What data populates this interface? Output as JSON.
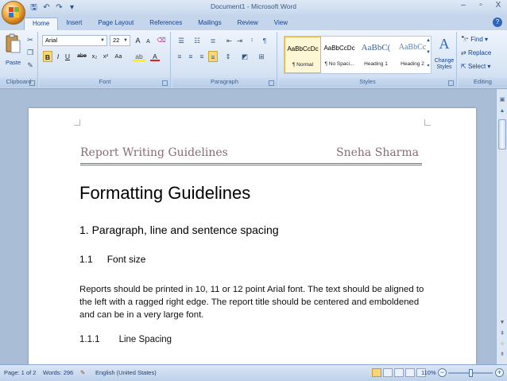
{
  "window": {
    "title": "Document1 - Microsoft Word",
    "controls": {
      "minimize": "–",
      "restore": "▫",
      "close": "X"
    }
  },
  "quick_access": {
    "save_icon": "save-icon",
    "undo_icon": "undo-icon",
    "redo_icon": "redo-icon"
  },
  "tabs": [
    {
      "label": "Home",
      "active": true
    },
    {
      "label": "Insert"
    },
    {
      "label": "Page Layout"
    },
    {
      "label": "References"
    },
    {
      "label": "Mailings"
    },
    {
      "label": "Review"
    },
    {
      "label": "View"
    }
  ],
  "ribbon": {
    "clipboard": {
      "label": "Clipboard",
      "paste": "Paste"
    },
    "font": {
      "label": "Font",
      "font_name": "Arial",
      "font_size": "22",
      "bold": "B",
      "italic": "I",
      "underline": "U",
      "strike": "abe",
      "subscript": "x₂",
      "superscript": "x²",
      "change_case": "Aa",
      "grow": "A",
      "shrink": "A",
      "clear": "⌫",
      "font_color": "A"
    },
    "paragraph": {
      "label": "Paragraph"
    },
    "styles": {
      "label": "Styles",
      "items": [
        {
          "sample": "AaBbCcDc",
          "name": "¶ Normal",
          "selected": true
        },
        {
          "sample": "AaBbCcDc",
          "name": "¶ No Spaci..."
        },
        {
          "sample": "AaBbC(",
          "name": "Heading 1"
        },
        {
          "sample": "AaBbCc",
          "name": "Heading 2"
        }
      ],
      "change_styles": "Change Styles"
    },
    "editing": {
      "label": "Editing",
      "find": "Find",
      "replace": "Replace",
      "select": "Select"
    }
  },
  "document": {
    "header_left": "Report Writing Guidelines",
    "header_right": "Sneha Sharma",
    "title": "Formatting Guidelines",
    "heading1": "1.  Paragraph, line and sentence spacing",
    "heading2_num": "1.1",
    "heading2_text": "Font size",
    "body": "Reports should be printed in 10, 11 or 12 point Arial font. The text should be aligned to the left with a ragged right edge. The report title should be centered and emboldened and can be in a very large font.",
    "heading3_num": "1.1.1",
    "heading3_text": "Line Spacing"
  },
  "status": {
    "page": "Page: 1 of 2",
    "words": "Words: 296",
    "language": "English (United States)",
    "zoom": "110%"
  }
}
